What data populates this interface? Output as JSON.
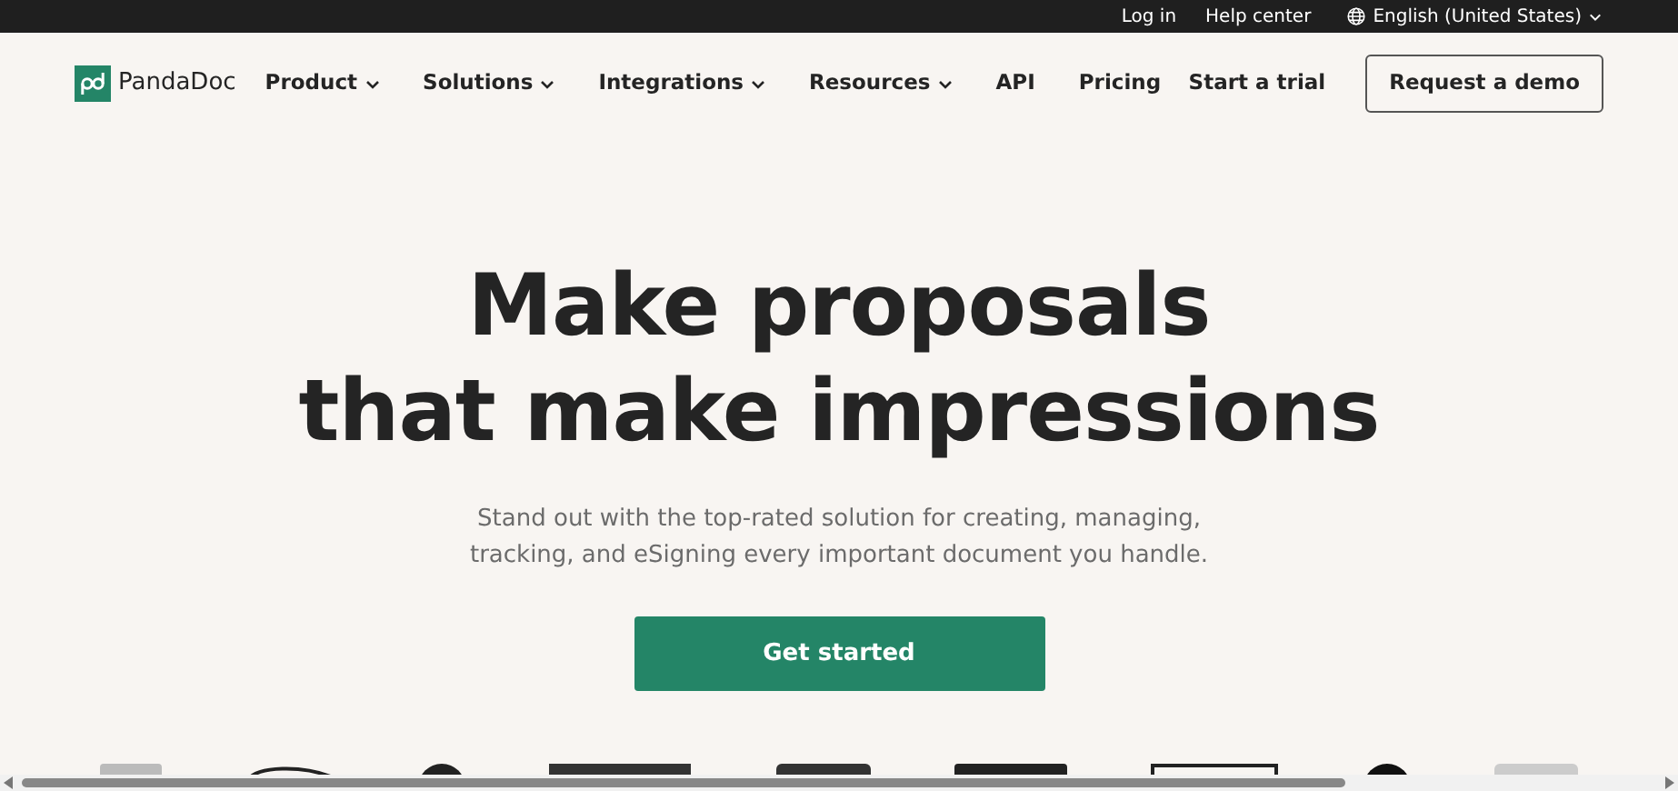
{
  "top_bar": {
    "links": [
      "Log in",
      "Help center"
    ],
    "language": {
      "label": "English (United States)"
    }
  },
  "header": {
    "brand": "PandaDoc",
    "nav": [
      {
        "label": "Product",
        "has_menu": true
      },
      {
        "label": "Solutions",
        "has_menu": true
      },
      {
        "label": "Integrations",
        "has_menu": true
      },
      {
        "label": "Resources",
        "has_menu": true
      },
      {
        "label": "API",
        "has_menu": false
      },
      {
        "label": "Pricing",
        "has_menu": false
      }
    ],
    "trial_link": "Start a trial",
    "demo_button": "Request a demo"
  },
  "hero": {
    "headline": [
      "Make proposals",
      "that make impressions"
    ],
    "subtitle": [
      "Stand out with the top-rated solution for creating, managing,",
      "tracking, and eSigning every important document you handle."
    ],
    "cta": "Get started"
  }
}
